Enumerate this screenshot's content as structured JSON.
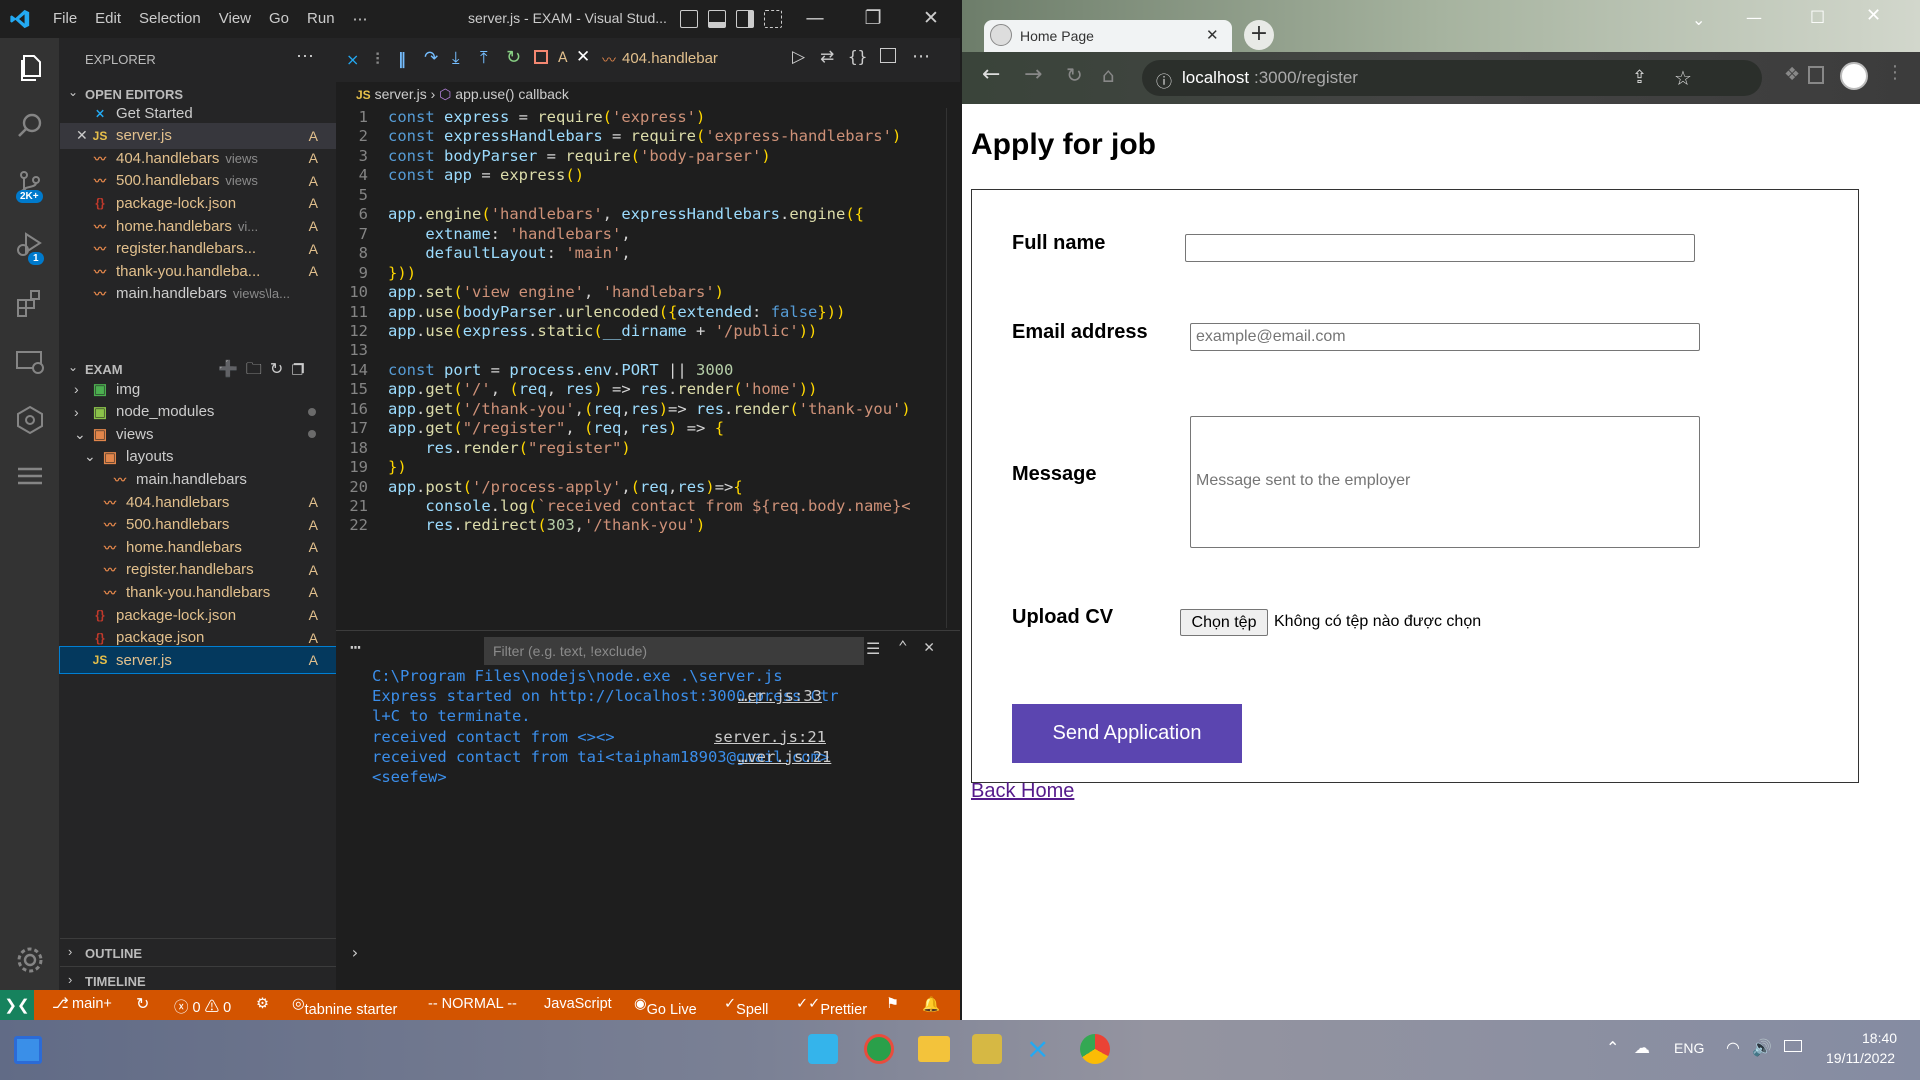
{
  "vscode": {
    "menu": [
      "File",
      "Edit",
      "Selection",
      "View",
      "Go",
      "Run",
      "⋯"
    ],
    "window_title": "server.js - EXAM - Visual Stud...",
    "activity_badges": {
      "scm": "2K+",
      "debug": "1"
    },
    "explorer": {
      "header": "EXPLORER",
      "open_editors_title": "OPEN EDITORS",
      "open_editors": [
        {
          "icon": "vscode",
          "name": "Get Started",
          "hint": "",
          "status": ""
        },
        {
          "icon": "js",
          "name": "server.js",
          "hint": "",
          "status": "A"
        },
        {
          "icon": "hb",
          "name": "404.handlebars",
          "hint": "views",
          "status": "A"
        },
        {
          "icon": "hb",
          "name": "500.handlebars",
          "hint": "views",
          "status": "A"
        },
        {
          "icon": "pk",
          "name": "package-lock.json",
          "hint": "",
          "status": "A"
        },
        {
          "icon": "hb",
          "name": "home.handlebars",
          "hint": "vi...",
          "status": "A"
        },
        {
          "icon": "hb",
          "name": "register.handlebars...",
          "hint": "",
          "status": "A"
        },
        {
          "icon": "hb",
          "name": "thank-you.handleba...",
          "hint": "",
          "status": "A"
        },
        {
          "icon": "hb",
          "name": "main.handlebars",
          "hint": "views\\la...",
          "status": ""
        }
      ],
      "workspace_title": "EXAM",
      "tree": [
        {
          "indent": 1,
          "chev": "›",
          "icon": "folder-img",
          "name": "img",
          "status": ""
        },
        {
          "indent": 1,
          "chev": "›",
          "icon": "folder-node",
          "name": "node_modules",
          "status": "dot"
        },
        {
          "indent": 1,
          "chev": "⌄",
          "icon": "folder-views",
          "name": "views",
          "status": "dot"
        },
        {
          "indent": 2,
          "chev": "⌄",
          "icon": "folder-layouts",
          "name": "layouts",
          "status": ""
        },
        {
          "indent": 3,
          "chev": "",
          "icon": "hb",
          "name": "main.handlebars",
          "status": ""
        },
        {
          "indent": 2,
          "chev": "",
          "icon": "hb",
          "name": "404.handlebars",
          "status": "A"
        },
        {
          "indent": 2,
          "chev": "",
          "icon": "hb",
          "name": "500.handlebars",
          "status": "A"
        },
        {
          "indent": 2,
          "chev": "",
          "icon": "hb",
          "name": "home.handlebars",
          "status": "A"
        },
        {
          "indent": 2,
          "chev": "",
          "icon": "hb",
          "name": "register.handlebars",
          "status": "A"
        },
        {
          "indent": 2,
          "chev": "",
          "icon": "hb",
          "name": "thank-you.handlebars",
          "status": "A"
        },
        {
          "indent": 1,
          "chev": "",
          "icon": "pk",
          "name": "package-lock.json",
          "status": "A"
        },
        {
          "indent": 1,
          "chev": "",
          "icon": "pk",
          "name": "package.json",
          "status": "A"
        },
        {
          "indent": 1,
          "chev": "",
          "icon": "js",
          "name": "server.js",
          "status": "A"
        }
      ],
      "outline_title": "OUTLINE",
      "timeline_title": "TIMELINE"
    },
    "tabs": {
      "server_status": "A",
      "other_tab": "404.handlebar"
    },
    "breadcrumb": {
      "file": "server.js",
      "sep": "›",
      "symbol": "app.use() callback"
    },
    "code_lines": [
      "const express = require('express')",
      "const expressHandlebars = require('express-handlebars')",
      "const bodyParser = require('body-parser')",
      "const app = express()",
      "",
      "app.engine('handlebars', expressHandlebars.engine({",
      "    extname: 'handlebars',",
      "    defaultLayout: 'main',",
      "}))",
      "app.set('view engine', 'handlebars')",
      "app.use(bodyParser.urlencoded({extended: false}))",
      "app.use(express.static(__dirname + '/public'))",
      "",
      "const port = process.env.PORT || 3000",
      "app.get('/', (req, res) => res.render('home'))",
      "app.get('/thank-you',(req,res)=> res.render('thank-you')",
      "app.get(\"/register\", (req, res) => {",
      "    res.render(\"register\")",
      "})",
      "app.post('/process-apply',(req,res)=>{",
      "    console.log(`received contact from ${req.body.name}<",
      "    res.redirect(303,'/thank-you')"
    ],
    "panel": {
      "filter_placeholder": "Filter (e.g. text, !exclude)",
      "lines": [
        {
          "text": "C:\\Program Files\\nodejs\\node.exe .\\server.js",
          "ref": ""
        },
        {
          "text": "Express started on http://localhost:3000;press Ctr",
          "ref": "…er.js:33"
        },
        {
          "text": "l+C to terminate.",
          "ref": ""
        },
        {
          "text": "received contact from <><>",
          "ref": "server.js:21"
        },
        {
          "text": "received contact from tai<taipham18903@gmail.com>",
          "ref": "…ver.js:21"
        },
        {
          "text": "<seefew>",
          "ref": ""
        }
      ]
    },
    "status_bar": {
      "branch": "main+",
      "problems": "ⓧ 0 ⚠ 0",
      "tabnine": "tabnine starter",
      "mode": "-- NORMAL --",
      "language": "JavaScript",
      "golive": "Go Live",
      "spell": "Spell",
      "prettier": "Prettier"
    }
  },
  "browser": {
    "tab_title": "Home Page",
    "url_host": "localhost",
    "url_path": ":3000/register",
    "page": {
      "heading": "Apply for job",
      "full_name_label": "Full name",
      "email_label": "Email address",
      "email_placeholder": "example@email.com",
      "message_label": "Message",
      "message_placeholder": "Message sent to the employer",
      "cv_label": "Upload CV",
      "file_button": "Chọn tệp",
      "file_status": "Không có tệp nào được chọn",
      "submit": "Send Application",
      "back_link": "Back Home"
    }
  },
  "taskbar": {
    "lang": "ENG",
    "time": "18:40",
    "date": "19/11/2022"
  },
  "colors": {
    "status_bar": "#d35400",
    "button": "#5b45b0",
    "vscode_bg": "#1e1e1e"
  }
}
